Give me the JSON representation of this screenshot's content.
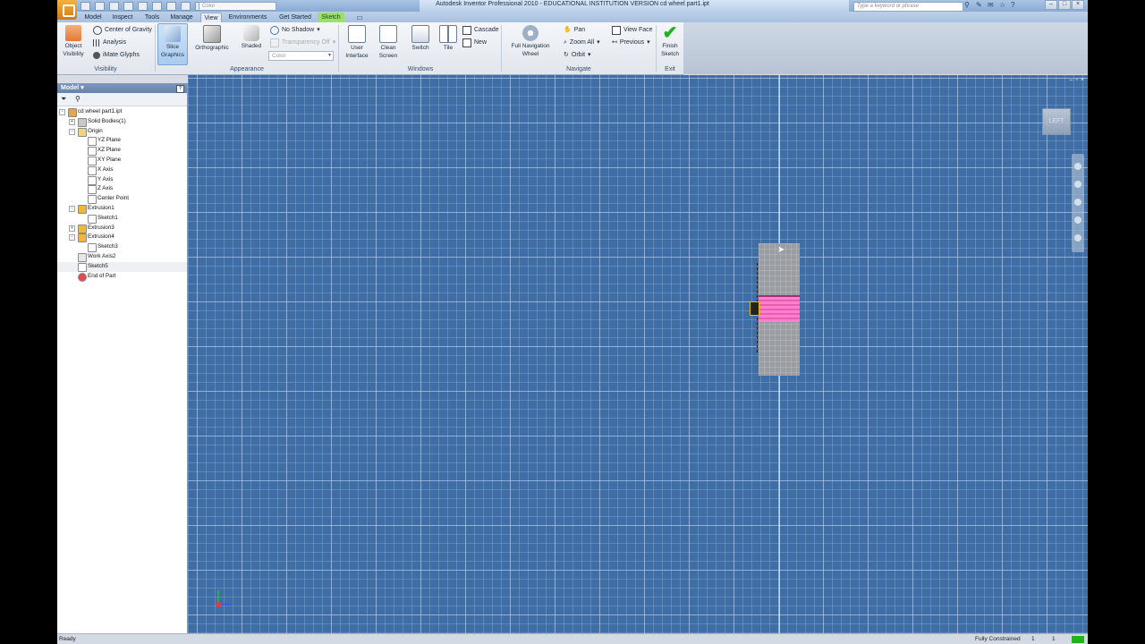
{
  "window": {
    "title": "Autodesk Inventor Professional 2010 - EDUCATIONAL INSTITUTION VERSION     cd wheel part1.ipt",
    "qat_combo": "Color",
    "search_placeholder": "Type a keyword or phrase"
  },
  "tabs": [
    "Model",
    "Inspect",
    "Tools",
    "Manage",
    "View",
    "Environments",
    "Get Started",
    "Sketch"
  ],
  "active_tab": "View",
  "ribbon": {
    "visibility": {
      "object_visibility": "Object\nVisibility",
      "center_of_gravity": "Center of Gravity",
      "analysis": "Analysis",
      "imate_glyphs": "iMate Glyphs",
      "panel_label": "Visibility"
    },
    "appearance": {
      "slice_graphics": "Slice\nGraphics",
      "orthographic": "Orthographic",
      "shaded": "Shaded",
      "no_shadow": "No Shadow",
      "transparency_off": "Transparency Off",
      "color_combo": "Color",
      "panel_label": "Appearance"
    },
    "windows": {
      "user_interface": "User\nInterface",
      "clean_screen": "Clean\nScreen",
      "switch": "Switch",
      "tile": "Tile",
      "cascade": "Cascade",
      "new": "New",
      "panel_label": "Windows"
    },
    "navigate": {
      "full_navigation_wheel": "Full Navigation\nWheel",
      "pan": "Pan",
      "zoom_all": "Zoom All",
      "orbit": "Orbit",
      "view_face": "View Face",
      "previous": "Previous",
      "panel_label": "Navigate"
    },
    "exit": {
      "finish_sketch": "Finish\nSketch",
      "panel_label": "Exit"
    }
  },
  "browser": {
    "title": "Model",
    "help": "?",
    "items": [
      {
        "label": "cd wheel part1.ipt",
        "level": 0,
        "icon": "part-icon",
        "expander": "-"
      },
      {
        "label": "Solid Bodies(1)",
        "level": 1,
        "icon": "solid-bodies-icon",
        "expander": "+"
      },
      {
        "label": "Origin",
        "level": 1,
        "icon": "folder-icon",
        "expander": "-"
      },
      {
        "label": "YZ Plane",
        "level": 2,
        "icon": "plane-icon",
        "expander": ""
      },
      {
        "label": "XZ Plane",
        "level": 2,
        "icon": "plane-icon",
        "expander": ""
      },
      {
        "label": "XY Plane",
        "level": 2,
        "icon": "plane-icon",
        "expander": ""
      },
      {
        "label": "X Axis",
        "level": 2,
        "icon": "axis-icon",
        "expander": ""
      },
      {
        "label": "Y Axis",
        "level": 2,
        "icon": "axis-icon",
        "expander": ""
      },
      {
        "label": "Z Axis",
        "level": 2,
        "icon": "axis-icon",
        "expander": ""
      },
      {
        "label": "Center Point",
        "level": 2,
        "icon": "point-icon",
        "expander": ""
      },
      {
        "label": "Extrusion1",
        "level": 1,
        "icon": "extrusion-icon",
        "expander": "-"
      },
      {
        "label": "Sketch1",
        "level": 2,
        "icon": "sketch-icon",
        "expander": ""
      },
      {
        "label": "Extrusion3",
        "level": 1,
        "icon": "extrusion-icon",
        "expander": "+"
      },
      {
        "label": "Extrusion4",
        "level": 1,
        "icon": "extrusion-icon",
        "expander": "-"
      },
      {
        "label": "Sketch3",
        "level": 2,
        "icon": "sketch-icon",
        "expander": ""
      },
      {
        "label": "Work Axis2",
        "level": 1,
        "icon": "work-axis-icon",
        "expander": ""
      },
      {
        "label": "Sketch5",
        "level": 1,
        "icon": "sketch-icon",
        "expander": ""
      },
      {
        "label": "End of Part",
        "level": 1,
        "icon": "end-of-part-icon",
        "expander": ""
      }
    ]
  },
  "viewport": {
    "viewcube_label": "LEFT"
  },
  "status": {
    "left": "Ready",
    "right": "Fully Constrained",
    "count1": "1",
    "count2": "1"
  },
  "colors": {
    "viewport_bg": "#3f6ea6",
    "sketch_tab": "#9be06a",
    "highlight_pink": "#ff7fcf",
    "finish_green": "#21b21c"
  }
}
